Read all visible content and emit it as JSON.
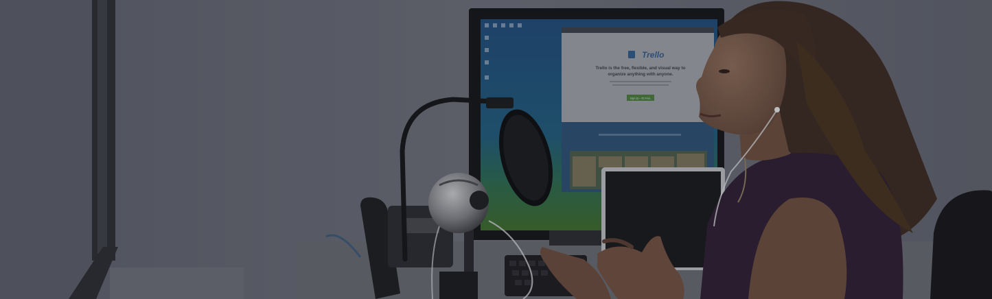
{
  "monitor_screen": {
    "brand": "Trello",
    "headline_line1": "Trello is the free, flexible, and visual way to",
    "headline_line2": "organize anything with anyone.",
    "cta_label": "Sign Up – It's Free."
  }
}
